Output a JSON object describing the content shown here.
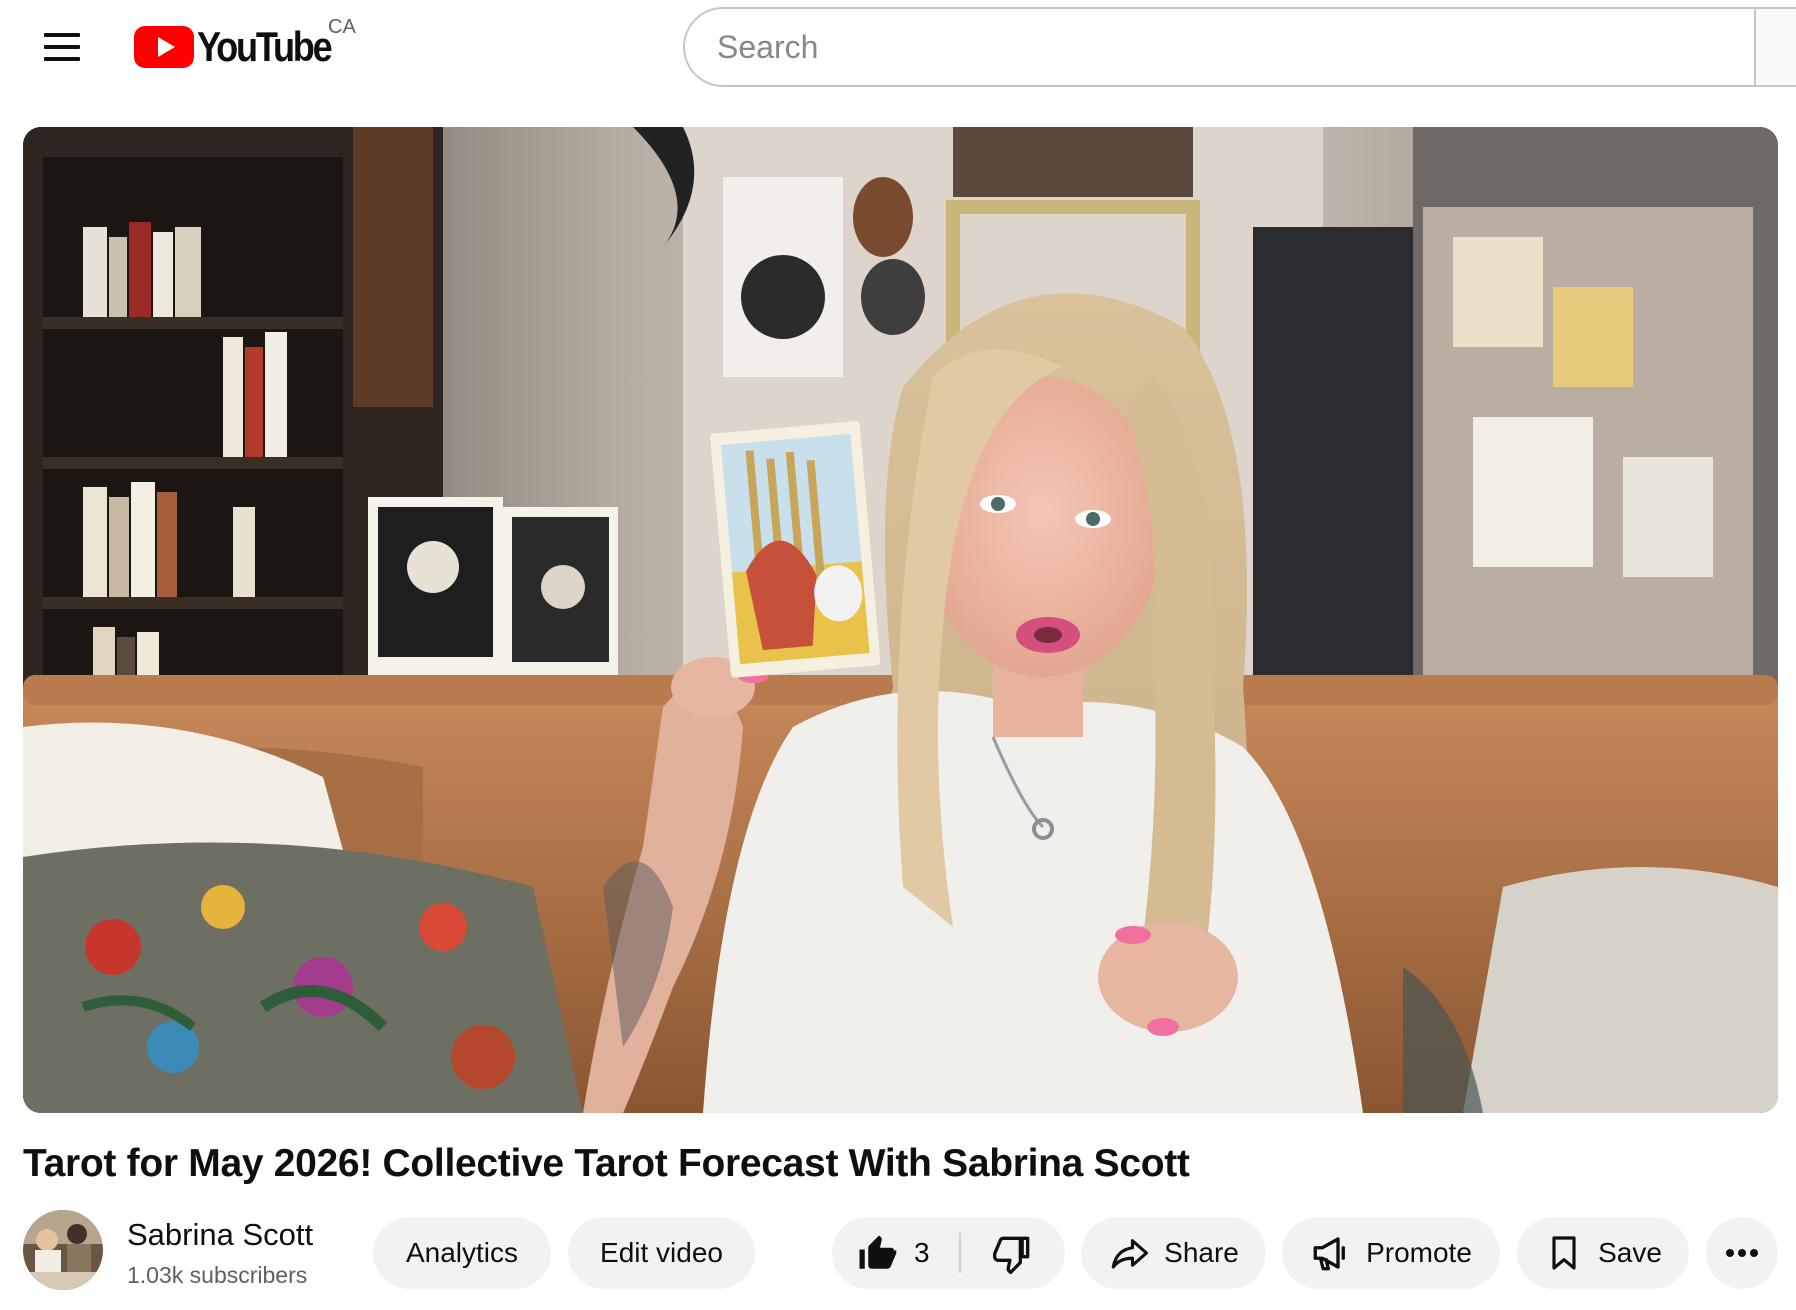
{
  "header": {
    "logo_text": "YouTube",
    "country_code": "CA",
    "search_placeholder": "Search"
  },
  "video": {
    "title": "Tarot for May 2026! Collective Tarot Forecast With Sabrina Scott"
  },
  "channel": {
    "name": "Sabrina Scott",
    "subscribers": "1.03k subscribers"
  },
  "actions": {
    "analytics_label": "Analytics",
    "edit_label": "Edit video",
    "like_count": "3",
    "share_label": "Share",
    "promote_label": "Promote",
    "save_label": "Save"
  },
  "colors": {
    "brand_red": "#ff0000",
    "pill_bg": "#f2f2f2",
    "text_primary": "#0f0f0f",
    "text_secondary": "#606060"
  },
  "icons": {
    "menu": "hamburger-menu-icon",
    "logo": "youtube-play-logo-icon",
    "like": "thumbs-up-icon",
    "dislike": "thumbs-down-icon",
    "share": "share-arrow-icon",
    "promote": "megaphone-icon",
    "save": "bookmark-icon",
    "more": "more-horizontal-icon"
  }
}
